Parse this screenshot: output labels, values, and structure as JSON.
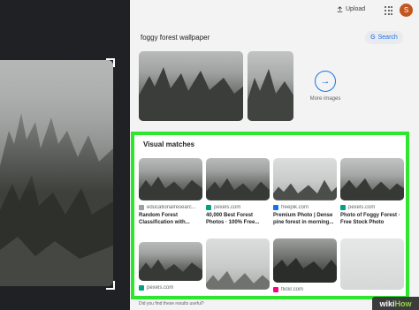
{
  "topbar": {
    "upload_label": "Upload",
    "avatar_letter": "S",
    "avatar_color": "#c3561f"
  },
  "query": {
    "text": "foggy forest wallpaper",
    "search_button": "Search"
  },
  "more_images": {
    "label": "More images",
    "arrow": "→"
  },
  "visual_matches": {
    "title": "Visual matches",
    "items": [
      {
        "source": "educationalresearc...",
        "title": "Random Forest Classification with...",
        "icon": "default-favicon"
      },
      {
        "source": "pexels.com",
        "title": "40,000 Best Forest Photos · 100% Free...",
        "icon": "pexels-favicon"
      },
      {
        "source": "freepik.com",
        "title": "Premium Photo | Dense pine forest in morning...",
        "icon": "freepik-favicon"
      },
      {
        "source": "pexels.com",
        "title": "Photo of Foggy Forest · Free Stock Photo",
        "icon": "pexels-favicon"
      },
      {
        "source": "pexels.com",
        "title": "",
        "icon": "pexels-favicon"
      },
      {
        "source": "",
        "title": "",
        "icon": ""
      },
      {
        "source": "flickr.com",
        "title": "",
        "icon": "flickr-favicon"
      },
      {
        "source": "",
        "title": "",
        "icon": ""
      }
    ]
  },
  "feedback": {
    "text": "Did you find these results useful?"
  },
  "watermark": {
    "prefix": "wiki",
    "suffix": "How"
  },
  "colors": {
    "highlight_border": "#2ee62e",
    "accent": "#1a73e8",
    "pexels": "#05a081",
    "freepik": "#1273eb"
  }
}
